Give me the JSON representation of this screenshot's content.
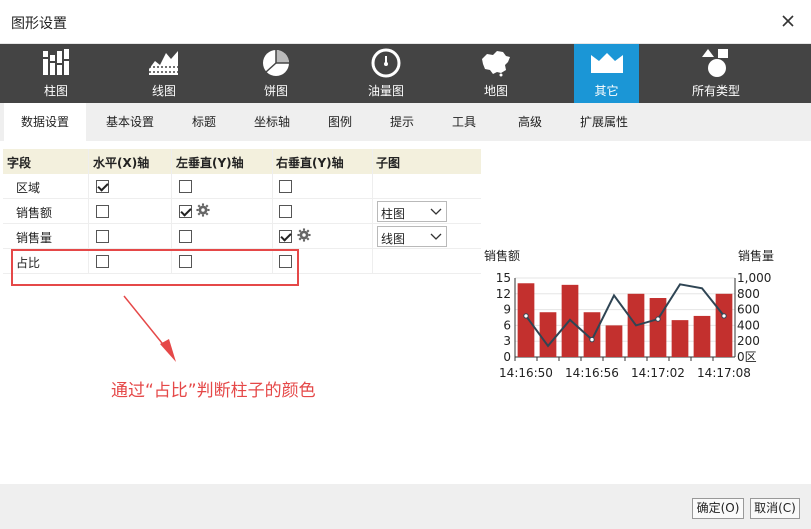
{
  "window": {
    "title": "图形设置"
  },
  "chart_types": [
    {
      "label": "柱图",
      "icon": "bar-chart-icon"
    },
    {
      "label": "线图",
      "icon": "line-chart-icon"
    },
    {
      "label": "饼图",
      "icon": "pie-chart-icon"
    },
    {
      "label": "油量图",
      "icon": "gauge-icon"
    },
    {
      "label": "地图",
      "icon": "china-map-icon"
    },
    {
      "label": "其它",
      "icon": "other-chart-icon",
      "active": true
    },
    {
      "label": "所有类型",
      "icon": "all-types-icon"
    }
  ],
  "subtabs": [
    {
      "label": "数据设置",
      "active": true
    },
    {
      "label": "基本设置"
    },
    {
      "label": "标题"
    },
    {
      "label": "坐标轴"
    },
    {
      "label": "图例"
    },
    {
      "label": "提示"
    },
    {
      "label": "工具"
    },
    {
      "label": "高级"
    },
    {
      "label": "扩展属性"
    }
  ],
  "grid": {
    "headers": {
      "field": "字段",
      "x_axis": "水平(X)轴",
      "left_y": "左垂直(Y)轴",
      "right_y": "右垂直(Y)轴",
      "subchart": "子图"
    },
    "rows": [
      {
        "field": "区域",
        "x": true,
        "left_y": false,
        "right_y": false,
        "subchart": ""
      },
      {
        "field": "销售额",
        "x": false,
        "left_y": true,
        "right_y": false,
        "subchart": "柱图"
      },
      {
        "field": "销售量",
        "x": false,
        "left_y": false,
        "right_y": true,
        "subchart": "线图"
      },
      {
        "field": "占比",
        "x": false,
        "left_y": false,
        "right_y": false,
        "subchart": ""
      }
    ]
  },
  "annotation": {
    "text": "通过“占比”判断柱子的颜色"
  },
  "chart_data": {
    "type": "bar",
    "left_axis_title": "销售额",
    "right_axis_title": "销售量",
    "left_ylim": [
      0,
      15
    ],
    "left_ticks": [
      "15",
      "12",
      "9",
      "6",
      "3",
      "0"
    ],
    "right_ylim": [
      0,
      1000
    ],
    "right_ticks": [
      "1,000",
      "800",
      "600",
      "400",
      "200",
      "0区"
    ],
    "x_ticks": [
      "14:16:50",
      "14:16:56",
      "14:17:02",
      "14:17:08"
    ],
    "bar_values": [
      14,
      8.5,
      13.7,
      8.5,
      6,
      12,
      11.2,
      7,
      7.8,
      12
    ],
    "line_values": [
      520,
      140,
      470,
      220,
      780,
      400,
      480,
      920,
      870,
      520
    ],
    "bar_color": "#c3302e",
    "line_color": "#2f4554"
  },
  "buttons": {
    "ok": "确定(O)",
    "cancel": "取消(C)"
  }
}
